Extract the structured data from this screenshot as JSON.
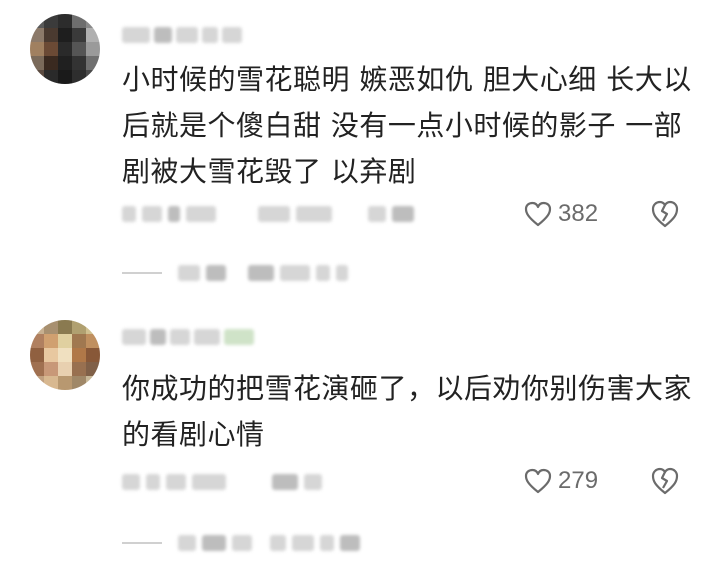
{
  "comments": [
    {
      "text": "小时候的雪花聪明  嫉恶如仇  胆大心细  长大以后就是个傻白甜   没有一点小时候的影子   一部剧被大雪花毁了   以弃剧",
      "like_count": "382",
      "icons": {
        "like": "heart-outline-icon",
        "dislike": "broken-heart-icon"
      }
    },
    {
      "text": "你成功的把雪花演砸了，以后劝你别伤害大家的看剧心情",
      "like_count": "279",
      "icons": {
        "like": "heart-outline-icon",
        "dislike": "broken-heart-icon"
      }
    }
  ],
  "colors": {
    "text": "#222222",
    "secondary": "#6b6b6b",
    "icon": "#6b6b6b",
    "background": "#ffffff"
  }
}
